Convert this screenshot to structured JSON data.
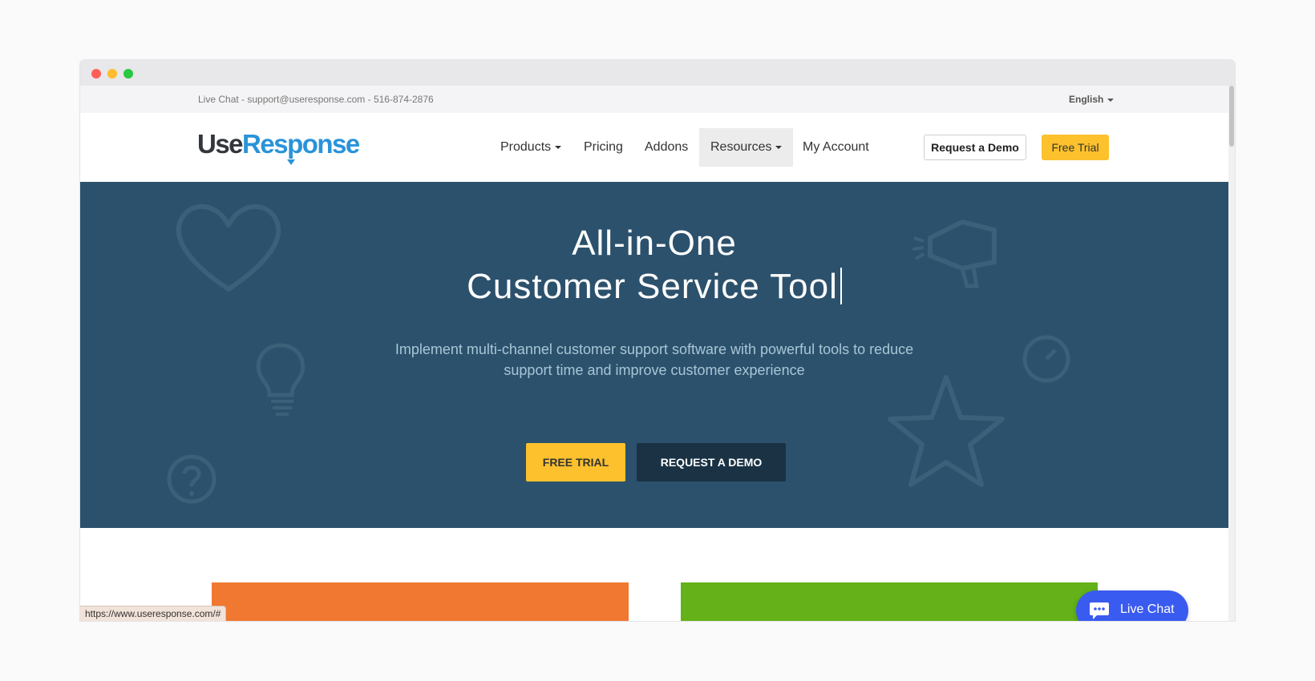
{
  "topbar": {
    "contact": "Live Chat - support@useresponse.com - 516-874-2876",
    "language": "English"
  },
  "logo": {
    "part1": "Use",
    "part2": "Response"
  },
  "nav": {
    "products": "Products",
    "pricing": "Pricing",
    "addons": "Addons",
    "resources": "Resources",
    "my_account": "My Account",
    "request_demo": "Request a Demo",
    "free_trial": "Free Trial"
  },
  "hero": {
    "title_line1": "All-in-One",
    "title_line2": "Customer Service Tool",
    "subtitle": "Implement multi-channel customer support software with powerful tools to reduce support time and improve customer experience",
    "btn_trial": "FREE TRIAL",
    "btn_demo": "REQUEST A DEMO"
  },
  "status_bar": {
    "url": "https://www.useresponse.com/#"
  },
  "livechat": {
    "label": "Live Chat"
  },
  "colors": {
    "accent_yellow": "#fcc12d",
    "hero_bg": "#2c516c",
    "brand_blue": "#2a93d9",
    "chat_blue": "#3a5bf0",
    "card_orange": "#f07830",
    "card_green": "#64b119"
  },
  "icons": [
    "heart-icon",
    "lightbulb-icon",
    "question-icon",
    "megaphone-icon",
    "clock-icon",
    "star-icon",
    "chat-bubble-icon"
  ]
}
